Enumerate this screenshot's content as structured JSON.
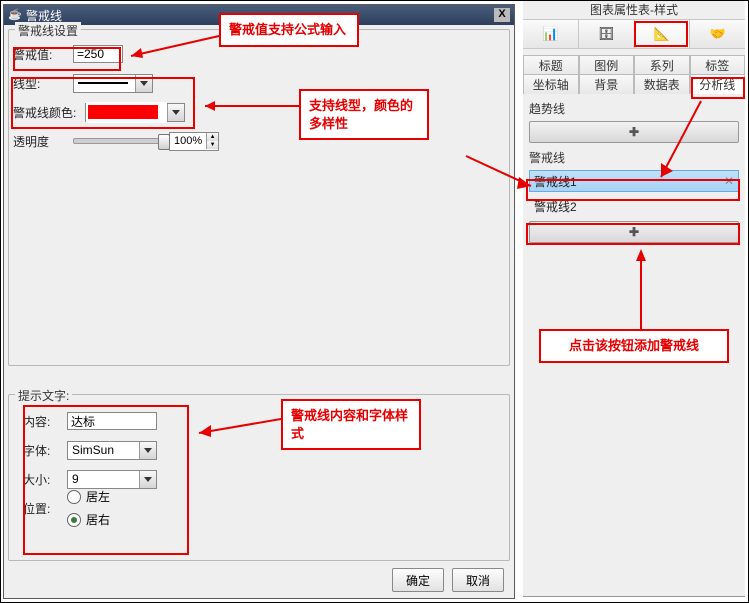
{
  "dialog": {
    "title": "警戒线",
    "fs1_label": "警戒线设置",
    "value_label": "警戒值:",
    "value": "=250",
    "line_type_label": "线型:",
    "color_label": "警戒线颜色:",
    "color_hex": "#ff0000",
    "opacity_label": "透明度",
    "opacity_value": "100%",
    "fs2_label": "提示文字:",
    "content_label": "内容:",
    "content_value": "达标",
    "font_label": "字体:",
    "font_value": "SimSun",
    "size_label": "大小:",
    "size_value": "9",
    "pos_label": "位置:",
    "pos_left": "居左",
    "pos_right": "居右",
    "ok": "确定",
    "cancel": "取消"
  },
  "right": {
    "title": "图表属性表-样式",
    "icon_tabs": [
      "📊",
      "🗄",
      "📐",
      "🤝"
    ],
    "text_tabs_row1": [
      "标题",
      "图例",
      "系列",
      "标签"
    ],
    "text_tabs_row2": [
      "坐标轴",
      "背景",
      "数据表",
      "分析线"
    ],
    "selected_text_tab": "分析线",
    "section_trend": "趋势线",
    "section_alert": "警戒线",
    "items": [
      "警戒线1",
      "警戒线2"
    ],
    "selected_item": "警戒线1",
    "plus": "✚"
  },
  "callouts": {
    "c1": "警戒值支持公式输入",
    "c2": "支持线型，颜色的多样性",
    "c3": "警戒线内容和字体样式",
    "c4": "点击该按钮添加警戒线"
  }
}
